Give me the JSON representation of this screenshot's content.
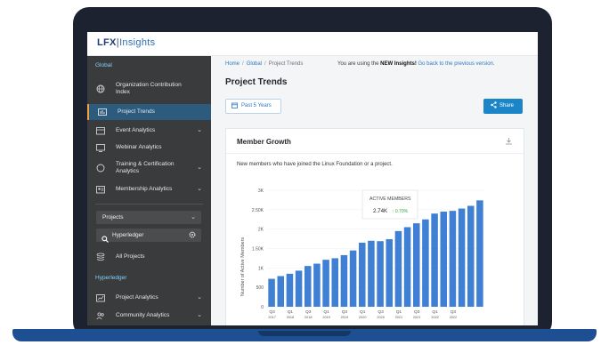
{
  "app": {
    "logo_main": "LFX",
    "logo_sub": "Insights"
  },
  "sidebar": {
    "global_label": "Global",
    "items": [
      {
        "label": "Organization Contribution Index",
        "icon": "globe-icon"
      },
      {
        "label": "Project Trends",
        "icon": "trends-icon",
        "active": true
      },
      {
        "label": "Event Analytics",
        "icon": "event-icon"
      },
      {
        "label": "Webinar Analytics",
        "icon": "webinar-icon"
      },
      {
        "label": "Training & Certification Analytics",
        "icon": "training-icon"
      },
      {
        "label": "Membership Analytics",
        "icon": "membership-icon"
      }
    ],
    "projects_select": "Projects",
    "search_value": "Hyperledger",
    "all_projects": "All Projects",
    "hyperledger_label": "Hyperledger",
    "sub_items": [
      {
        "label": "Project Analytics",
        "icon": "project-analytics-icon"
      },
      {
        "label": "Community Analytics",
        "icon": "community-icon"
      }
    ]
  },
  "header": {
    "breadcrumb": [
      "Home",
      "Global",
      "Project Trends"
    ],
    "notice_prefix": "You are using the",
    "notice_bold": "NEW Insights!",
    "notice_link": "Go back to the previous version."
  },
  "main": {
    "title": "Project Trends",
    "date_button": "Past 5 Years",
    "share_button": "Share"
  },
  "card": {
    "title": "Member Growth",
    "description": "New members who have joined the Linux Foundation or a project.",
    "tooltip_label": "ACTIVE MEMBERS",
    "tooltip_value": "2.74K",
    "tooltip_change": "↑ 0.70%",
    "bar_color": "#3f80d4"
  },
  "chart_data": {
    "type": "bar",
    "ylabel": "Number of Active Members",
    "ylim": [
      0,
      3000
    ],
    "yticks": [
      "0",
      "500",
      "1K",
      "1.50K",
      "2K",
      "2.50K",
      "3K"
    ],
    "xtick_labels": [
      {
        "q": "Q3",
        "y": "2017"
      },
      {
        "q": "Q1",
        "y": "2018"
      },
      {
        "q": "Q3",
        "y": "2018"
      },
      {
        "q": "Q1",
        "y": "2019"
      },
      {
        "q": "Q3",
        "y": "2019"
      },
      {
        "q": "Q1",
        "y": "2020"
      },
      {
        "q": "Q3",
        "y": "2020"
      },
      {
        "q": "Q1",
        "y": "2021"
      },
      {
        "q": "Q3",
        "y": "2021"
      },
      {
        "q": "Q1",
        "y": "2022"
      },
      {
        "q": "Q3",
        "y": "2022"
      }
    ],
    "values": [
      720,
      790,
      850,
      930,
      1050,
      1110,
      1210,
      1250,
      1330,
      1450,
      1650,
      1700,
      1690,
      1740,
      1950,
      2050,
      2150,
      2250,
      2400,
      2450,
      2470,
      2530,
      2600,
      2740
    ]
  }
}
